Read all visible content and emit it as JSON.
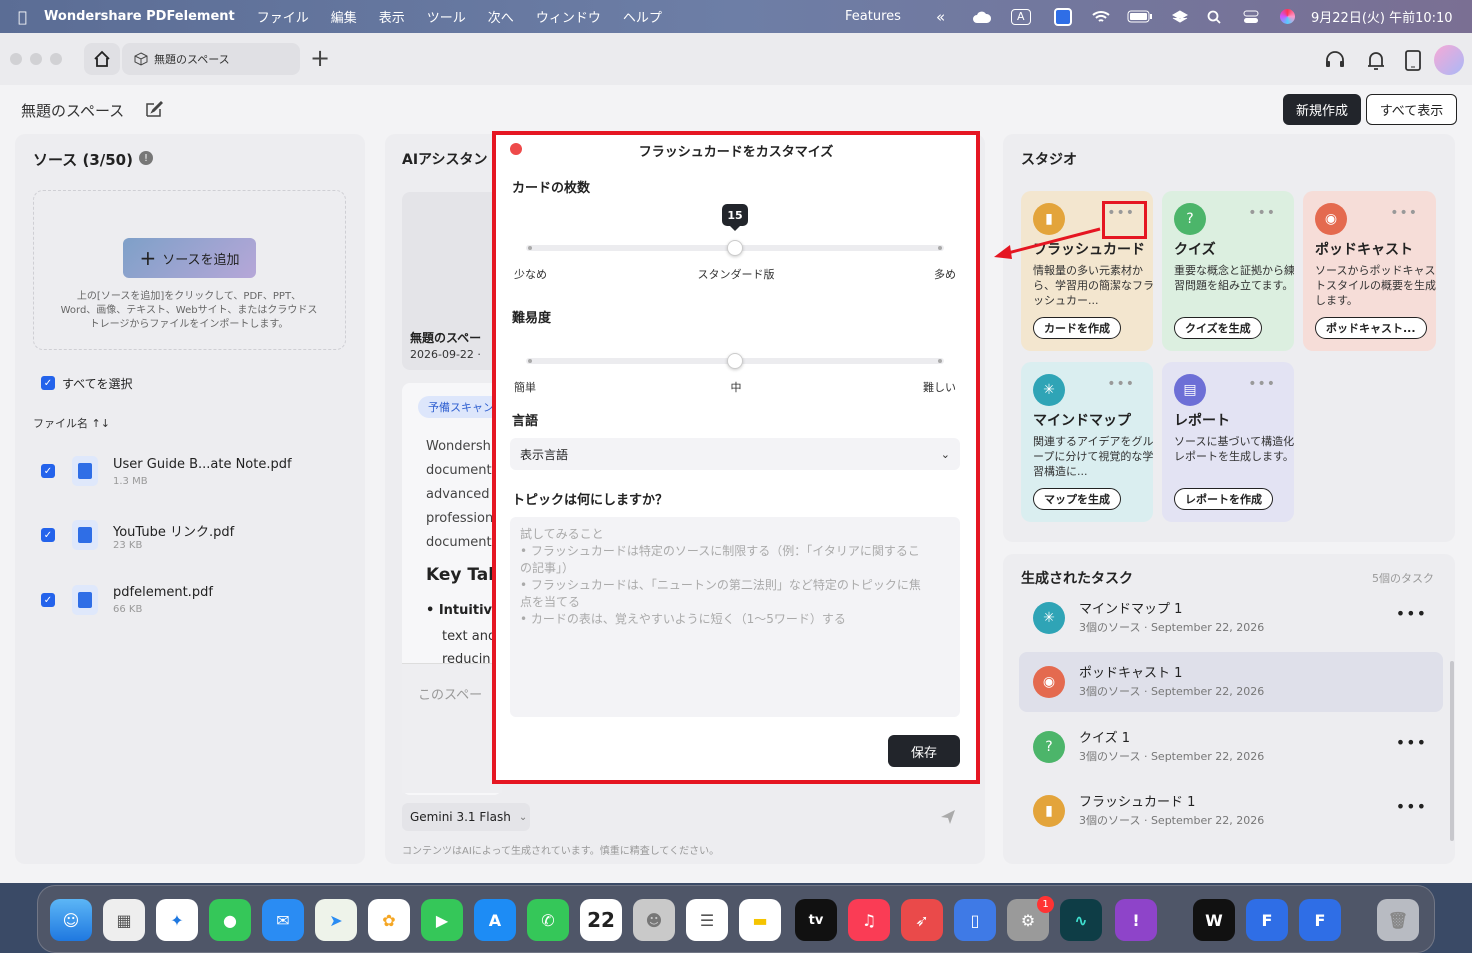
{
  "menubar": {
    "app_name": "Wondershare PDFelement",
    "items": [
      "ファイル",
      "編集",
      "表示",
      "ツール",
      "次へ",
      "ウィンドウ",
      "ヘルプ"
    ],
    "features": "Features",
    "datetime": "9月22日(火) 午前10:10",
    "input_label": "A"
  },
  "toolbar": {
    "space_tab": "無題のスペース"
  },
  "header": {
    "title": "無題のスペース",
    "new_button": "新規作成",
    "show_all_button": "すべて表示"
  },
  "sources": {
    "title": "ソース (3/50)",
    "add_button": "ソースを追加",
    "hint": "上の[ソースを追加]をクリックして、PDF、PPT、Word、画像、テキスト、Webサイト、またはクラウドストレージからファイルをインポートします。",
    "select_all": "すべてを選択",
    "sort_label": "ファイル名 ↑↓",
    "files": [
      {
        "name": "User Guide B...ate Note.pdf",
        "size": "1.3 MB"
      },
      {
        "name": "YouTube リンク.pdf",
        "size": "23 KB"
      },
      {
        "name": "pdfelement.pdf",
        "size": "66 KB"
      }
    ]
  },
  "ai": {
    "title": "AIアシスタン",
    "note_title": "無題のスペー",
    "note_date": "2026-09-22 ·",
    "tag": "予備スキャン",
    "body_lines": [
      "Wondersh",
      "document",
      "advanced",
      "profession",
      "document"
    ],
    "key_heading": "Key Tak",
    "bullet_head": "Intuitiv",
    "bullet_lines": [
      "text and",
      "reducin"
    ],
    "space_prompt": "このスペー",
    "model": "Gemini 3.1 Flash",
    "disclaimer": "コンテンツはAIによって生成されています。慎重に精査してください。"
  },
  "modal": {
    "title": "フラッシュカードをカスタマイズ",
    "count_label": "カードの枚数",
    "count_value": "15",
    "count_fraction": 0.5,
    "count_min": "少なめ",
    "count_mid": "スタンダード版",
    "count_max": "多め",
    "difficulty_label": "難易度",
    "difficulty_fraction": 0.5,
    "diff_min": "簡単",
    "diff_mid": "中",
    "diff_max": "難しい",
    "language_label": "言語",
    "language_value": "表示言語",
    "topic_label": "トピックは何にしますか？",
    "topic_placeholder": [
      "試してみること",
      "• フラッシュカードは特定のソースに制限する（例：「イタリアに関するこ",
      "の記事」）",
      "• フラッシュカードは、「ニュートンの第二法則」など特定のトピックに焦",
      "点を当てる",
      "• カードの表は、覚えやすいように短く（1〜5ワード）する"
    ],
    "save_button": "保存"
  },
  "studio": {
    "title": "スタジオ",
    "cards": [
      {
        "name": "フラッシュカード",
        "desc": "情報量の多い元素材から、学習用の簡潔なフラッシュカー...",
        "button": "カードを作成",
        "color": "#f3e6cf",
        "icon_color": "#e3a43b"
      },
      {
        "name": "クイズ",
        "desc": "重要な概念と証拠から練習問題を組み立てます。",
        "button": "クイズを生成",
        "color": "#dcefe0",
        "icon_color": "#4cb56a"
      },
      {
        "name": "ポッドキャスト",
        "desc": "ソースからポッドキャストスタイルの概要を生成します。",
        "button": "ポッドキャスト...",
        "color": "#f6ddd8",
        "icon_color": "#e46a4f"
      },
      {
        "name": "マインドマップ",
        "desc": "関連するアイデアをグループに分けて視覚的な学習構造に...",
        "button": "マップを生成",
        "color": "#daeef0",
        "icon_color": "#2fa4b6"
      },
      {
        "name": "レポート",
        "desc": "ソースに基づいて構造化レポートを生成します。",
        "button": "レポートを作成",
        "color": "#e3e3f3",
        "icon_color": "#6d6fd6"
      }
    ]
  },
  "tasks": {
    "title": "生成されたタスク",
    "count": "5個のタスク",
    "items": [
      {
        "name": "マインドマップ 1",
        "meta": "3個のソース · September 22, 2026",
        "icon_color": "#2fa4b6"
      },
      {
        "name": "ポッドキャスト 1",
        "meta": "3個のソース · September 22, 2026",
        "icon_color": "#e46a4f"
      },
      {
        "name": "クイズ 1",
        "meta": "3個のソース · September 22, 2026",
        "icon_color": "#4cb56a"
      },
      {
        "name": "フラッシュカード 1",
        "meta": "3個のソース · September 22, 2026",
        "icon_color": "#e3a43b"
      }
    ]
  },
  "dock": {
    "calendar_day": "22",
    "badge": "1"
  },
  "colors": {
    "highlight": "#e51622",
    "accent": "#2463eb"
  }
}
